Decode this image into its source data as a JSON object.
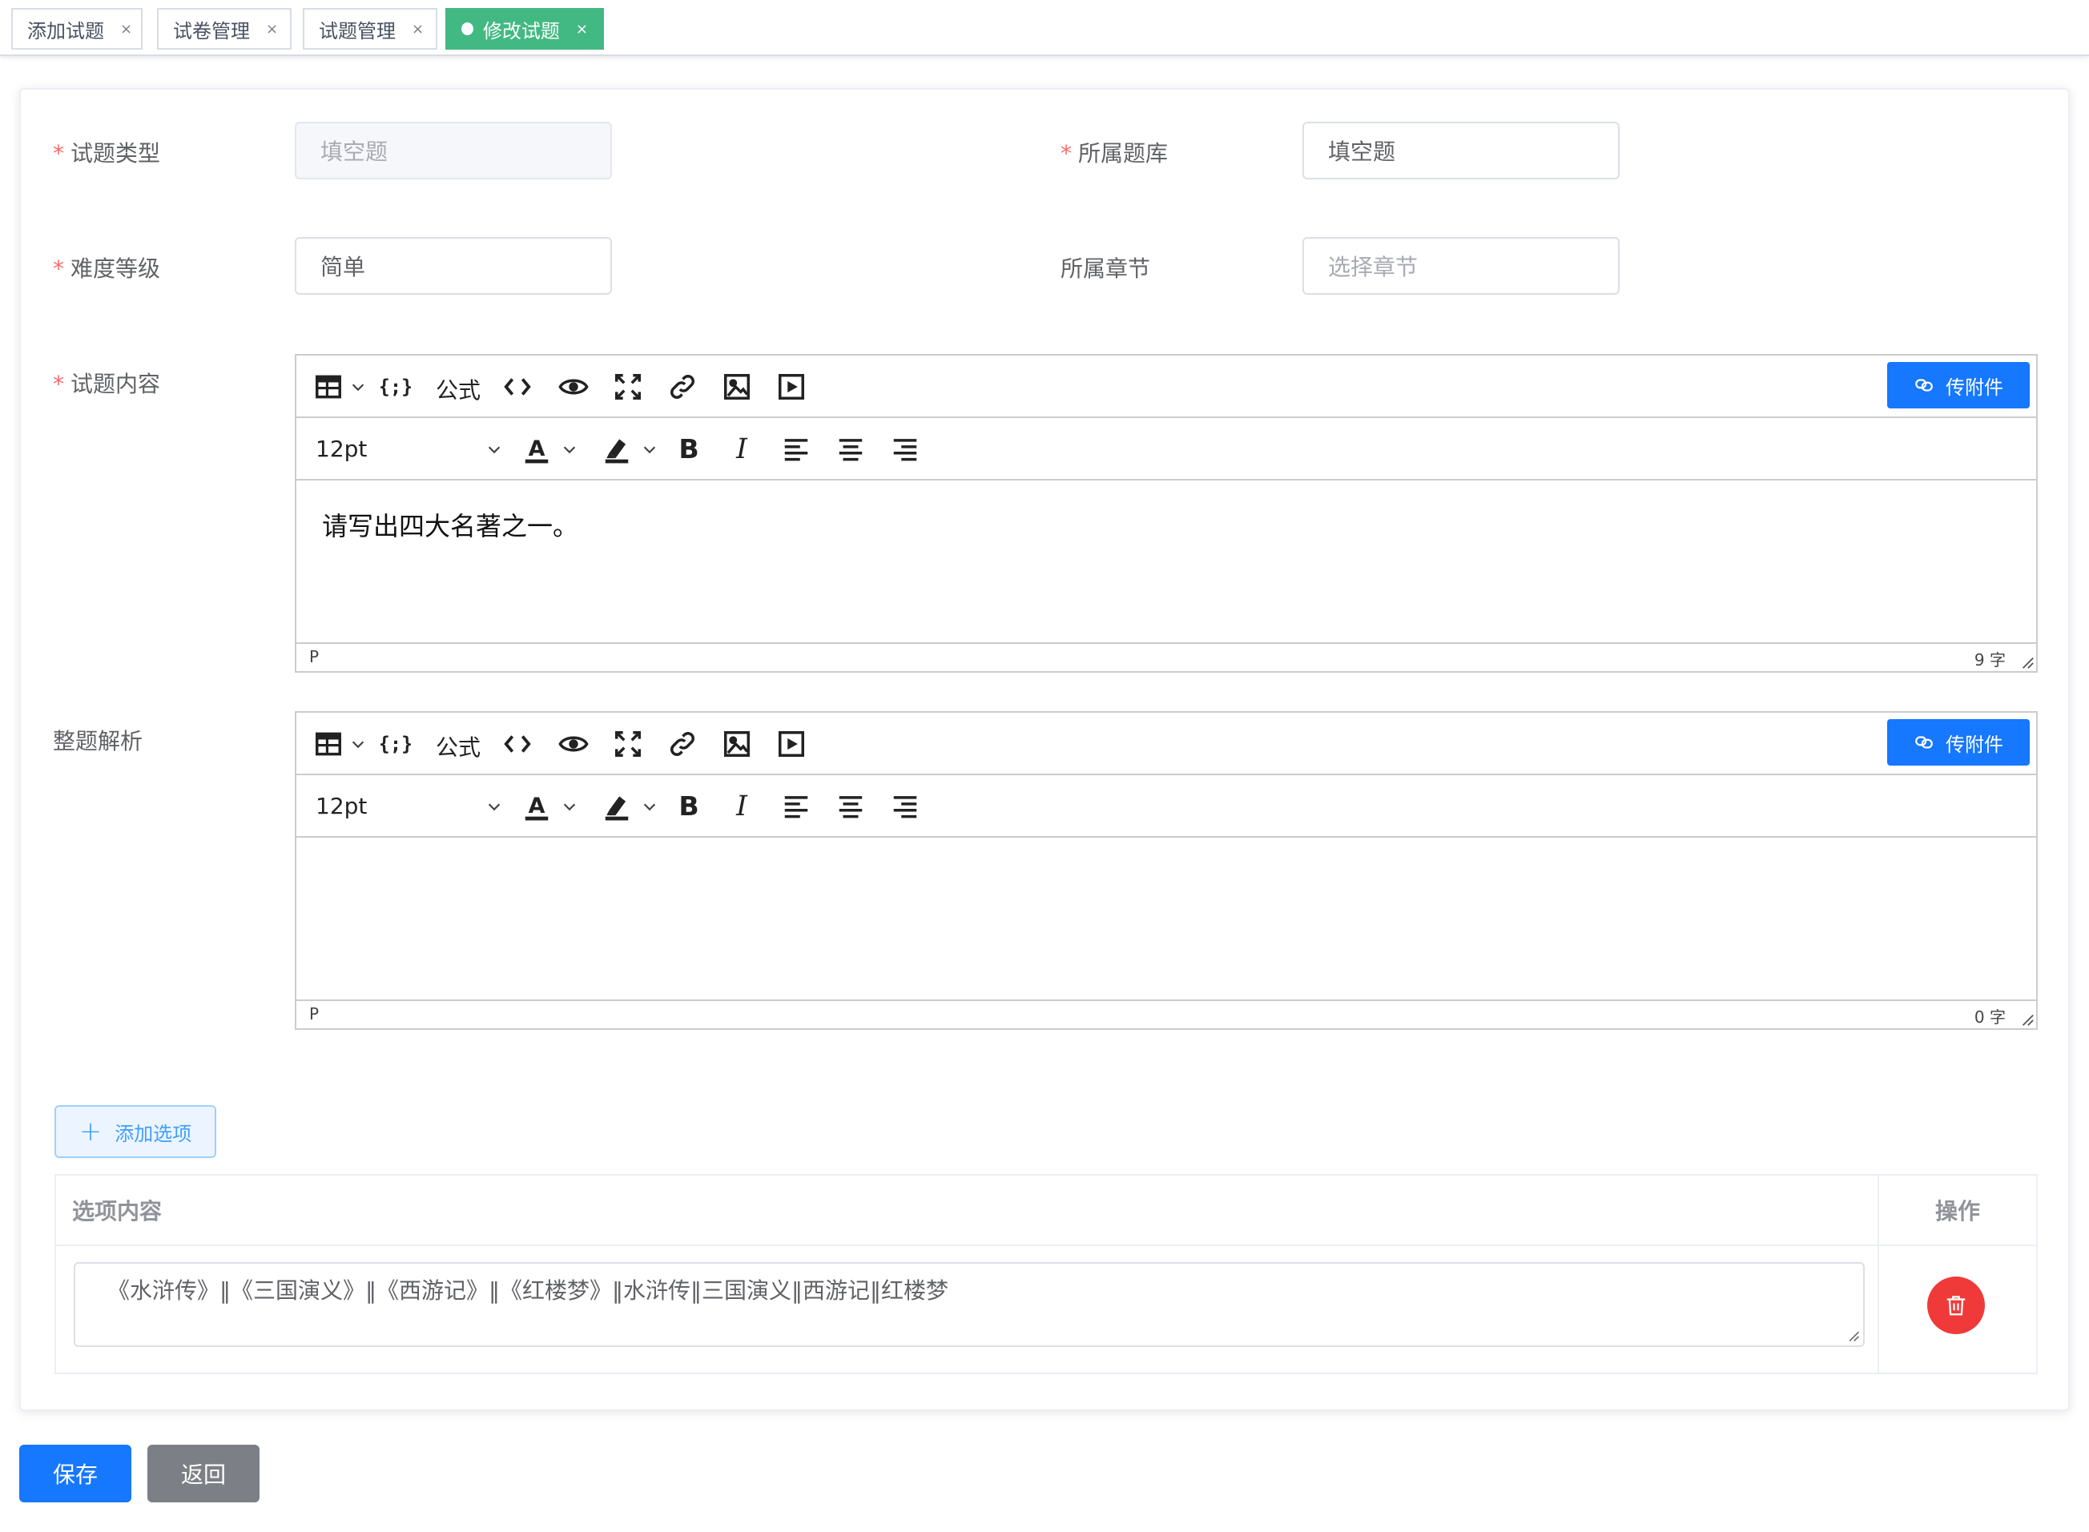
{
  "tabs": [
    {
      "label": "添加试题",
      "close": "×"
    },
    {
      "label": "试卷管理",
      "close": "×"
    },
    {
      "label": "试题管理",
      "close": "×"
    },
    {
      "label": "修改试题",
      "close": "×",
      "active": true
    }
  ],
  "colors": {
    "active_tab": "#42b983",
    "primary": "#1677ff",
    "danger": "#f03a3a",
    "required": "#f56c6c"
  },
  "form": {
    "required_mark": "*",
    "question_type": {
      "label": "试题类型",
      "value": "填空题",
      "disabled": true
    },
    "question_bank": {
      "label": "所属题库",
      "value": "填空题"
    },
    "difficulty": {
      "label": "难度等级",
      "value": "简单"
    },
    "chapter": {
      "label": "所属章节",
      "placeholder": "选择章节"
    },
    "content_label": "试题内容",
    "analysis_label": "整题解析"
  },
  "editor_toolbar": {
    "row1_icons": [
      "table-icon",
      "code-sample-icon",
      "formula",
      "source-code-icon",
      "preview-icon",
      "fullscreen-icon",
      "link-icon",
      "image-icon",
      "media-icon"
    ],
    "formula_label": "公式",
    "upload_label": "传附件",
    "font_size": "12pt",
    "row2_icons": [
      "text-color-icon",
      "highlight-icon",
      "bold-icon",
      "italic-icon",
      "align-left-icon",
      "align-center-icon",
      "align-right-icon"
    ]
  },
  "content_editor": {
    "text": "请写出四大名著之一。",
    "path": "P",
    "word_count": "9 字"
  },
  "analysis_editor": {
    "text": "",
    "path": "P",
    "word_count": "0 字"
  },
  "options": {
    "add_label": "添加选项",
    "header_content": "选项内容",
    "header_action": "操作",
    "rows": [
      {
        "content": "《水浒传》‖《三国演义》‖《西游记》‖《红楼梦》‖水浒传‖三国演义‖西游记‖红楼梦"
      }
    ]
  },
  "buttons": {
    "save": "保存",
    "back": "返回"
  }
}
